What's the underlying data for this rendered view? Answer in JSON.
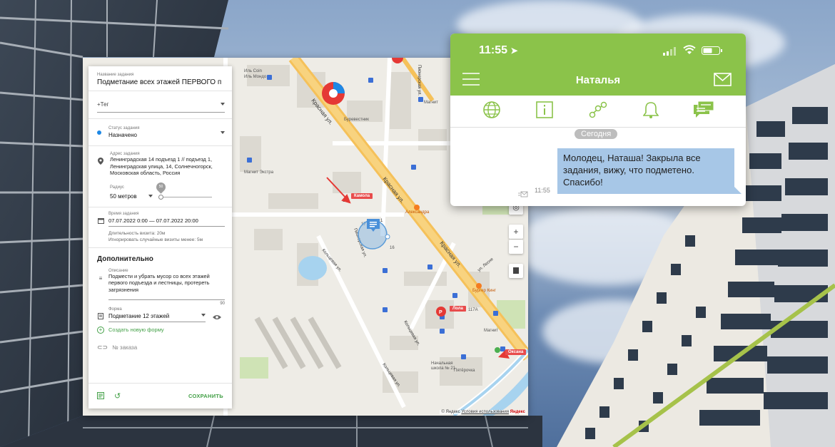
{
  "task_panel": {
    "title_label": "Название задания",
    "title_value": "Подметание всех этажей ПЕРВОГО п",
    "tag_placeholder": "+Тег",
    "status_label": "Статус задания",
    "status_value": "Назначено",
    "address_label": "Адрес задания",
    "address_value": "Ленинградская 14 подъезд 1 // подъезд 1, Ленинградская улица, 14, Солнечногорск, Московская область, Россия",
    "radius_label": "Радиус",
    "radius_value": "50 метров",
    "radius_slider_value": "50",
    "time_label": "Время задания",
    "time_value": "07.07.2022 0:00 — 07.07.2022 20:00",
    "visit_duration": "Длительность визита: 20м",
    "ignore_visits": "Игнорировать случайные визиты менее: 5м",
    "extra_title": "Дополнительно",
    "description_label": "Описание",
    "description_value": "Подмести и убрать мусор со всех этажей первого подъезда и лестницы, протереть загрязнения",
    "description_counter": "90",
    "form_label": "Форма",
    "form_value": "Подметание 12 этажей",
    "create_form_link": "Создать новую форму",
    "order_placeholder": "№ заказа",
    "save_label": "СОХРАНИТЬ"
  },
  "map": {
    "street_labels": [
      "Красная ул.",
      "Красная ул.",
      "Пионерская ул.",
      "Кольцевая ул.",
      "Кольцевая ул.",
      "Кольцевая ул.",
      "ул. Лесне"
    ],
    "poi_labels": [
      "Иль Coin",
      "Иль Мондо",
      "Буревестник",
      "Магнит",
      "Магнит Экстра",
      "Александра",
      "Бургер Кинг",
      "Магнит",
      "Пятёрочка",
      "Начальная школа № 21",
      "Пионерская ул."
    ],
    "house_numbers": [
      "18",
      "17",
      "16",
      "117А",
      "1"
    ],
    "tags": [
      "Камола",
      "Лола",
      "Оксана"
    ],
    "zoom_in": "+",
    "zoom_out": "−",
    "footer_copyright": "© Яндекс",
    "footer_terms": "Условия использования",
    "footer_brand": "Яндекс"
  },
  "chat": {
    "status_time": "11:55",
    "contact_name": "Наталья",
    "date_badge": "Сегодня",
    "message_text": "Молодец, Наташа! Закрыла все задания, вижу, что подметено. Спасибо!",
    "message_time": "11:55",
    "tabs": [
      "globe-icon",
      "info-icon",
      "route-icon",
      "bell-icon",
      "chat-icon"
    ]
  },
  "colors": {
    "accent_green": "#8bc34a",
    "bubble_blue": "#a7c7e7",
    "map_tag_red": "#e84c4c",
    "link_green": "#43a047"
  }
}
